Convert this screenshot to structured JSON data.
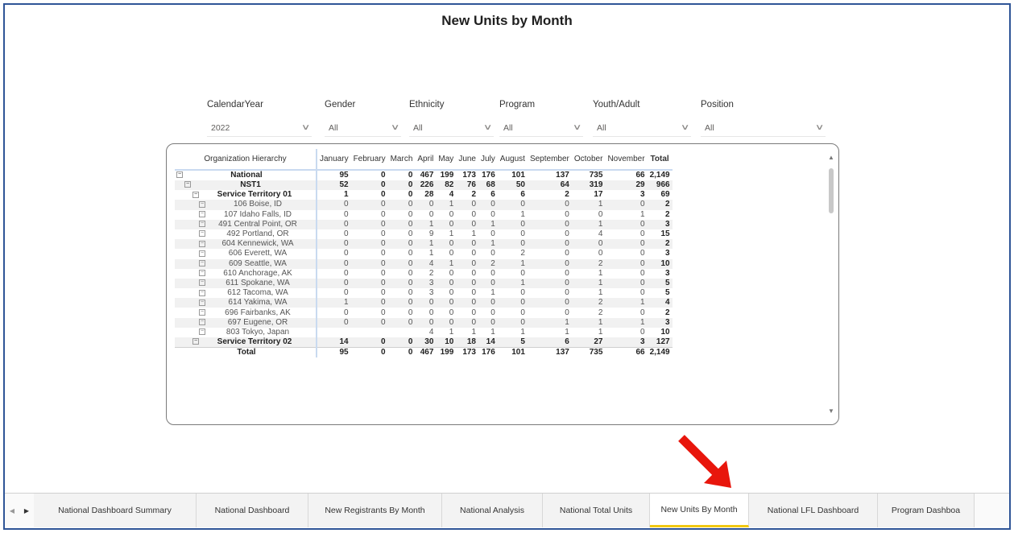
{
  "page": {
    "title": "New Units by Month"
  },
  "slicers": [
    {
      "label": "CalendarYear",
      "value": "2022"
    },
    {
      "label": "Gender",
      "value": "All"
    },
    {
      "label": "Ethnicity",
      "value": "All"
    },
    {
      "label": "Program",
      "value": "All"
    },
    {
      "label": "Youth/Adult",
      "value": "All"
    },
    {
      "label": "Position",
      "value": "All"
    }
  ],
  "matrix": {
    "headers": [
      "Organization Hierarchy",
      "January",
      "February",
      "March",
      "April",
      "May",
      "June",
      "July",
      "August",
      "September",
      "October",
      "November",
      "Total"
    ],
    "rows": [
      {
        "name": "National",
        "level": 0,
        "bold": true,
        "values": [
          "95",
          "0",
          "0",
          "467",
          "199",
          "173",
          "176",
          "101",
          "137",
          "735",
          "66",
          "2,149"
        ]
      },
      {
        "name": "NST1",
        "level": 1,
        "bold": true,
        "values": [
          "52",
          "0",
          "0",
          "226",
          "82",
          "76",
          "68",
          "50",
          "64",
          "319",
          "29",
          "966"
        ]
      },
      {
        "name": "Service Territory 01",
        "level": 2,
        "bold": true,
        "values": [
          "1",
          "0",
          "0",
          "28",
          "4",
          "2",
          "6",
          "6",
          "2",
          "17",
          "3",
          "69"
        ]
      },
      {
        "name": "106 Boise, ID",
        "level": 3,
        "values": [
          "0",
          "0",
          "0",
          "0",
          "1",
          "0",
          "0",
          "0",
          "0",
          "1",
          "0",
          "2"
        ]
      },
      {
        "name": "107 Idaho Falls, ID",
        "level": 3,
        "values": [
          "0",
          "0",
          "0",
          "0",
          "0",
          "0",
          "0",
          "1",
          "0",
          "0",
          "1",
          "2"
        ]
      },
      {
        "name": "491 Central Point, OR",
        "level": 3,
        "values": [
          "0",
          "0",
          "0",
          "1",
          "0",
          "0",
          "1",
          "0",
          "0",
          "1",
          "0",
          "3"
        ]
      },
      {
        "name": "492 Portland, OR",
        "level": 3,
        "values": [
          "0",
          "0",
          "0",
          "9",
          "1",
          "1",
          "0",
          "0",
          "0",
          "4",
          "0",
          "15"
        ]
      },
      {
        "name": "604 Kennewick, WA",
        "level": 3,
        "values": [
          "0",
          "0",
          "0",
          "1",
          "0",
          "0",
          "1",
          "0",
          "0",
          "0",
          "0",
          "2"
        ]
      },
      {
        "name": "606 Everett, WA",
        "level": 3,
        "values": [
          "0",
          "0",
          "0",
          "1",
          "0",
          "0",
          "0",
          "2",
          "0",
          "0",
          "0",
          "3"
        ]
      },
      {
        "name": "609 Seattle, WA",
        "level": 3,
        "values": [
          "0",
          "0",
          "0",
          "4",
          "1",
          "0",
          "2",
          "1",
          "0",
          "2",
          "0",
          "10"
        ]
      },
      {
        "name": "610 Anchorage, AK",
        "level": 3,
        "values": [
          "0",
          "0",
          "0",
          "2",
          "0",
          "0",
          "0",
          "0",
          "0",
          "1",
          "0",
          "3"
        ]
      },
      {
        "name": "611 Spokane, WA",
        "level": 3,
        "values": [
          "0",
          "0",
          "0",
          "3",
          "0",
          "0",
          "0",
          "1",
          "0",
          "1",
          "0",
          "5"
        ]
      },
      {
        "name": "612 Tacoma, WA",
        "level": 3,
        "values": [
          "0",
          "0",
          "0",
          "3",
          "0",
          "0",
          "1",
          "0",
          "0",
          "1",
          "0",
          "5"
        ]
      },
      {
        "name": "614 Yakima, WA",
        "level": 3,
        "values": [
          "1",
          "0",
          "0",
          "0",
          "0",
          "0",
          "0",
          "0",
          "0",
          "2",
          "1",
          "4"
        ]
      },
      {
        "name": "696 Fairbanks, AK",
        "level": 3,
        "values": [
          "0",
          "0",
          "0",
          "0",
          "0",
          "0",
          "0",
          "0",
          "0",
          "2",
          "0",
          "2"
        ]
      },
      {
        "name": "697 Eugene, OR",
        "level": 3,
        "values": [
          "0",
          "0",
          "0",
          "0",
          "0",
          "0",
          "0",
          "0",
          "1",
          "1",
          "1",
          "3"
        ]
      },
      {
        "name": "803 Tokyo, Japan",
        "level": 3,
        "values": [
          "",
          "",
          "",
          "4",
          "1",
          "1",
          "1",
          "1",
          "1",
          "1",
          "0",
          "10"
        ]
      },
      {
        "name": "Service Territory 02",
        "level": 2,
        "bold": true,
        "values": [
          "14",
          "0",
          "0",
          "30",
          "10",
          "18",
          "14",
          "5",
          "6",
          "27",
          "3",
          "127"
        ]
      }
    ],
    "total": {
      "name": "Total",
      "values": [
        "95",
        "0",
        "0",
        "467",
        "199",
        "173",
        "176",
        "101",
        "137",
        "735",
        "66",
        "2,149"
      ]
    }
  },
  "tabs": [
    "National Dashboard Summary",
    "National Dashboard",
    "New Registrants By Month",
    "National Analysis",
    "National Total Units",
    "New Units By Month",
    "National LFL Dashboard",
    "Program Dashboa"
  ],
  "active_tab": "New Units By Month",
  "colors": {
    "accent": "#f2c811",
    "frame": "#2f5597",
    "arrow": "#e8160c"
  },
  "icons": {
    "expand": "square-minus-icon",
    "dropdown": "chevron-down-icon",
    "annotation": "red-arrow-icon"
  }
}
